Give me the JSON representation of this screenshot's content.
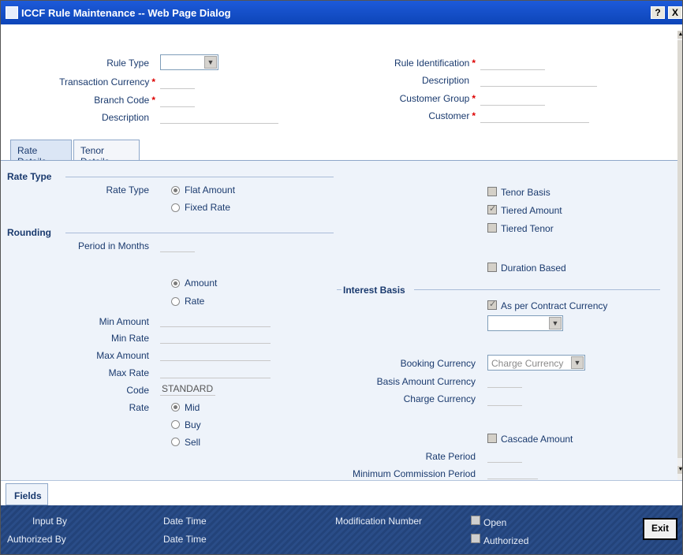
{
  "window": {
    "title": "ICCF Rule Maintenance -- Web Page Dialog",
    "help": "?",
    "close": "X"
  },
  "header": {
    "rule_type_label": "Rule Type",
    "rule_type_value": "",
    "transaction_currency_label": "Transaction Currency",
    "branch_code_label": "Branch Code",
    "description_label": "Description",
    "rule_identification_label": "Rule Identification",
    "description2_label": "Description",
    "customer_group_label": "Customer Group",
    "customer_label": "Customer",
    "required_mark": "*"
  },
  "tabs": [
    {
      "label": "Rate Details"
    },
    {
      "label": "Tenor Details"
    }
  ],
  "rate_details": {
    "rate_type_section": "Rate Type",
    "rate_type_label": "Rate Type",
    "flat_amount": "Flat Amount",
    "fixed_rate": "Fixed Rate",
    "rounding_section": "Rounding",
    "period_in_months_label": "Period in Months",
    "amount": "Amount",
    "rate": "Rate",
    "min_amount_label": "Min Amount",
    "min_rate_label": "Min Rate",
    "max_amount_label": "Max Amount",
    "max_rate_label": "Max Rate",
    "code_label": "Code",
    "code_value": "STANDARD",
    "rate_label": "Rate",
    "mid": "Mid",
    "buy": "Buy",
    "sell": "Sell",
    "tenor_basis": "Tenor Basis",
    "tiered_amount": "Tiered Amount",
    "tiered_tenor": "Tiered Tenor",
    "duration_based": "Duration Based",
    "interest_basis_section": "Interest Basis",
    "as_per_contract_currency": "As per Contract Currency",
    "booking_currency_label": "Booking Currency",
    "booking_currency_value": "Charge Currency",
    "basis_amount_currency_label": "Basis Amount Currency",
    "charge_currency_label": "Charge Currency",
    "cascade_amount": "Cascade Amount",
    "rate_period_label": "Rate Period",
    "minimum_commission_period_label": "Minimum Commission Period"
  },
  "fields_button": "Fields",
  "footer": {
    "input_by": "Input By",
    "authorized_by": "Authorized By",
    "date_time_1": "Date Time",
    "date_time_2": "Date Time",
    "modification_number": "Modification Number",
    "open": "Open",
    "authorized": "Authorized",
    "exit": "Exit"
  },
  "colors": {
    "title_bar": "#0d45b8",
    "label_text": "#1a3a6e",
    "required": "#dd0000",
    "footer": "#23437a",
    "panel": "#eef3fa"
  }
}
